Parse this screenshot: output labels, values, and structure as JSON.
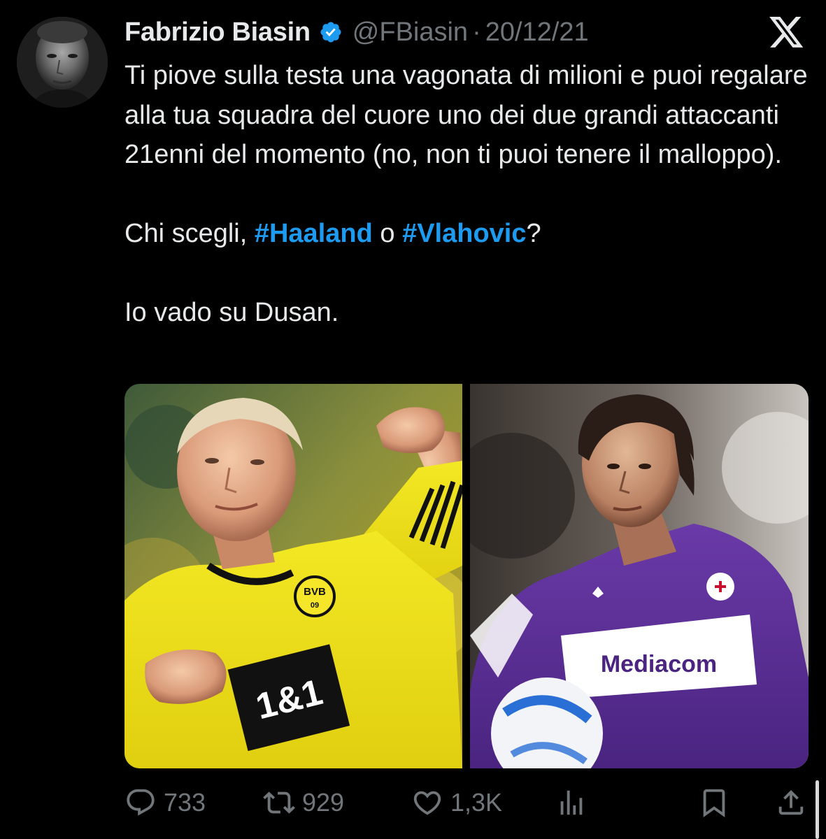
{
  "author": {
    "name": "Fabrizio Biasin",
    "verified": true,
    "handle": "@FBiasin",
    "separator": "·",
    "date": "20/12/21"
  },
  "tweet": {
    "paragraph_1": "Ti piove sulla testa una vagonata di milioni e puoi regalare alla tua squadra del cuore uno dei due grandi attaccanti 21enni del momento (no, non ti puoi tenere il malloppo).",
    "question_prefix": "Chi scegli, ",
    "hashtag_1": "#Haaland",
    "question_middle": " o ",
    "hashtag_2": "#Vlahovic",
    "question_suffix": "?",
    "paragraph_3": "Io vado su Dusan."
  },
  "media": {
    "left_photo": {
      "jersey_sponsor": "1&1",
      "badge_text_top": "BVB",
      "badge_text_bottom": "09"
    },
    "right_photo": {
      "jersey_sponsor": "Mediacom"
    }
  },
  "actions": {
    "replies": "733",
    "reposts": "929",
    "likes": "1,3K"
  },
  "icons": {
    "verified": "verified-badge-icon",
    "platform": "x-logo-icon",
    "reply": "reply-icon",
    "repost": "repost-icon",
    "like": "heart-icon",
    "views": "views-icon",
    "bookmark": "bookmark-icon",
    "share": "share-icon"
  },
  "colors": {
    "background": "#000000",
    "text": "#e7e9ea",
    "secondary": "#71767b",
    "hashtag": "#1d9bf0",
    "verified": "#1d9bf0"
  }
}
